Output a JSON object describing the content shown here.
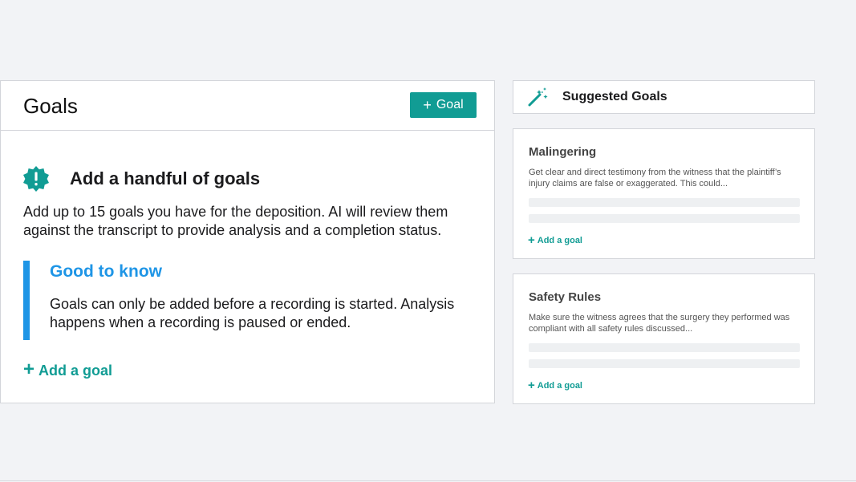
{
  "goals": {
    "title": "Goals",
    "add_button_label": "Goal",
    "add_button_plus": "+",
    "empty_state": {
      "title": "Add a handful of goals",
      "description": "Add up to 15 goals you have for the deposition. AI will review them against the transcript to provide analysis and a completion status.",
      "callout_title": "Good to know",
      "callout_text": "Goals can only be added before a recording is started. Analysis happens when a recording is paused or ended."
    },
    "add_link_label": "Add a goal",
    "add_link_plus": "+"
  },
  "suggested": {
    "title": "Suggested Goals",
    "cards": [
      {
        "title": "Malingering",
        "description": "Get clear and direct testimony from the witness that the plaintiff’s injury claims are false or exaggerated. This could...",
        "add_label": "Add a goal",
        "add_plus": "+"
      },
      {
        "title": "Safety Rules",
        "description": "Make sure the witness agrees that the surgery they performed was compliant with all safety rules discussed...",
        "add_label": "Add a goal",
        "add_plus": "+"
      }
    ]
  },
  "icons": {
    "alert": "alert-badge-icon",
    "wand": "magic-wand-icon"
  },
  "colors": {
    "accent_teal": "#119c94",
    "info_blue": "#1e95e6",
    "background": "#f2f3f6"
  }
}
